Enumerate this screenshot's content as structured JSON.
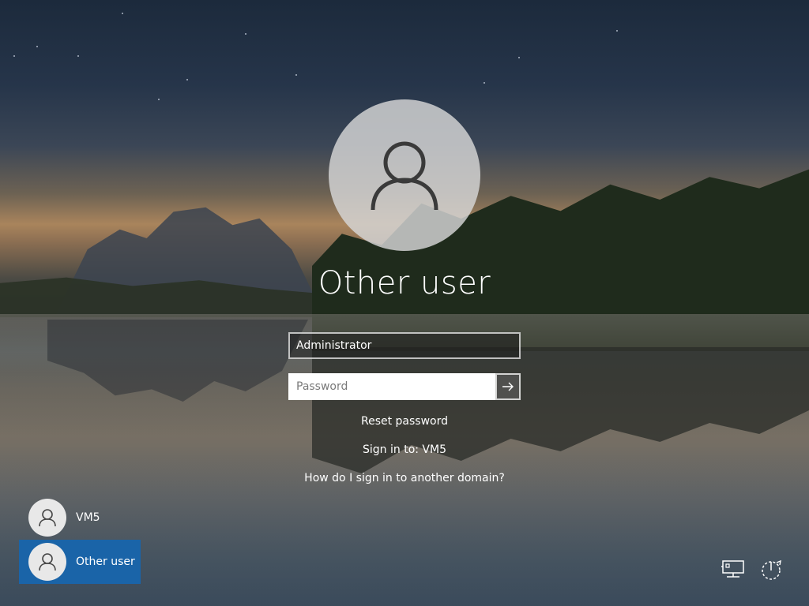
{
  "login": {
    "user_name": "Other user",
    "username_value": "Administrator",
    "password_placeholder": "Password",
    "submit_icon": "arrow-right-icon",
    "avatar_icon": "user-icon"
  },
  "links": {
    "reset_password": "Reset password",
    "sign_in_to": "Sign in to: VM5",
    "other_domain": "How do I sign in to another domain?"
  },
  "user_list": [
    {
      "label": "VM5",
      "icon": "user-icon",
      "selected": false
    },
    {
      "label": "Other user",
      "icon": "user-icon",
      "selected": true
    }
  ],
  "system_icons": [
    {
      "name": "network-icon"
    },
    {
      "name": "power-icon"
    }
  ],
  "colors": {
    "selected_tile": "#1a64a8",
    "text": "#ffffff"
  }
}
